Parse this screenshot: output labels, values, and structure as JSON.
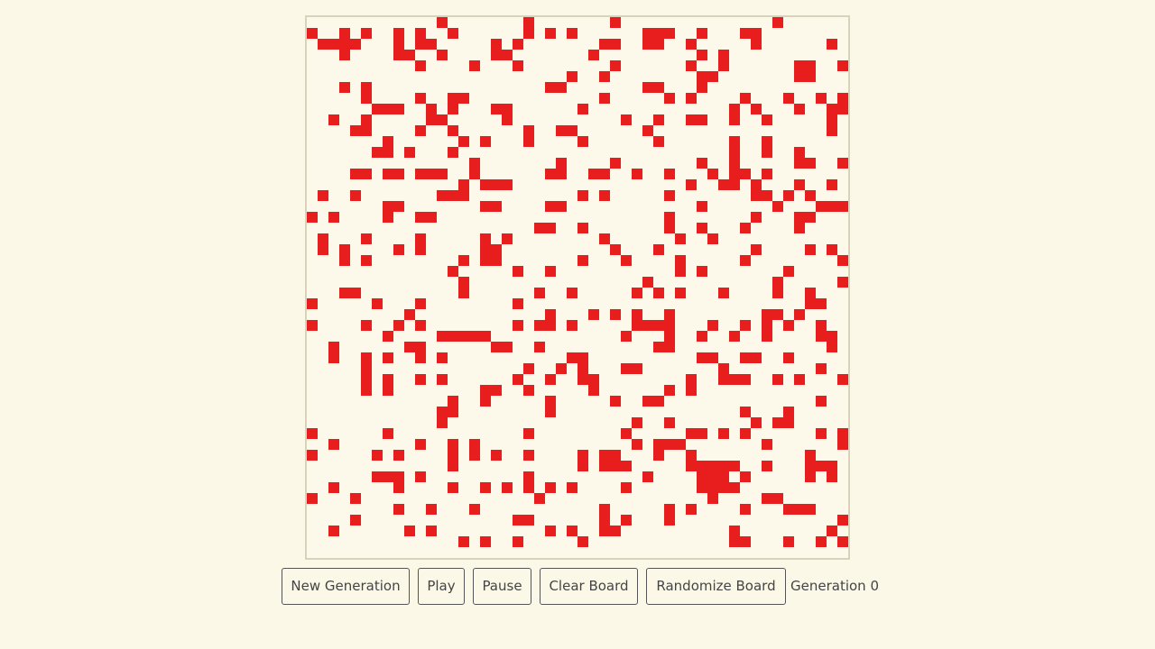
{
  "colors": {
    "background": "#fcf8e8",
    "alive_cell": "#e81e1e",
    "board_border": "#d8d4bc"
  },
  "board": {
    "columns": 50,
    "rows": 50,
    "alive_cells": [
      [
        12,
        0
      ],
      [
        20,
        0
      ],
      [
        28,
        0
      ],
      [
        43,
        0
      ],
      [
        0,
        1
      ],
      [
        3,
        1
      ],
      [
        5,
        1
      ],
      [
        8,
        1
      ],
      [
        10,
        1
      ],
      [
        13,
        1
      ],
      [
        20,
        1
      ],
      [
        22,
        1
      ],
      [
        24,
        1
      ],
      [
        31,
        1
      ],
      [
        32,
        1
      ],
      [
        33,
        1
      ],
      [
        36,
        1
      ],
      [
        40,
        1
      ],
      [
        41,
        1
      ],
      [
        1,
        2
      ],
      [
        2,
        2
      ],
      [
        3,
        2
      ],
      [
        4,
        2
      ],
      [
        8,
        2
      ],
      [
        10,
        2
      ],
      [
        11,
        2
      ],
      [
        17,
        2
      ],
      [
        19,
        2
      ],
      [
        27,
        2
      ],
      [
        28,
        2
      ],
      [
        31,
        2
      ],
      [
        32,
        2
      ],
      [
        35,
        2
      ],
      [
        41,
        2
      ],
      [
        48,
        2
      ],
      [
        3,
        3
      ],
      [
        8,
        3
      ],
      [
        9,
        3
      ],
      [
        12,
        3
      ],
      [
        17,
        3
      ],
      [
        18,
        3
      ],
      [
        26,
        3
      ],
      [
        36,
        3
      ],
      [
        38,
        3
      ],
      [
        10,
        4
      ],
      [
        15,
        4
      ],
      [
        19,
        4
      ],
      [
        28,
        4
      ],
      [
        35,
        4
      ],
      [
        38,
        4
      ],
      [
        45,
        4
      ],
      [
        46,
        4
      ],
      [
        49,
        4
      ],
      [
        24,
        5
      ],
      [
        27,
        5
      ],
      [
        36,
        5
      ],
      [
        37,
        5
      ],
      [
        45,
        5
      ],
      [
        46,
        5
      ],
      [
        3,
        6
      ],
      [
        5,
        6
      ],
      [
        22,
        6
      ],
      [
        23,
        6
      ],
      [
        31,
        6
      ],
      [
        32,
        6
      ],
      [
        36,
        6
      ],
      [
        5,
        7
      ],
      [
        10,
        7
      ],
      [
        13,
        7
      ],
      [
        14,
        7
      ],
      [
        27,
        7
      ],
      [
        33,
        7
      ],
      [
        35,
        7
      ],
      [
        40,
        7
      ],
      [
        44,
        7
      ],
      [
        47,
        7
      ],
      [
        49,
        7
      ],
      [
        6,
        8
      ],
      [
        7,
        8
      ],
      [
        8,
        8
      ],
      [
        11,
        8
      ],
      [
        13,
        8
      ],
      [
        17,
        8
      ],
      [
        18,
        8
      ],
      [
        25,
        8
      ],
      [
        39,
        8
      ],
      [
        41,
        8
      ],
      [
        45,
        8
      ],
      [
        48,
        8
      ],
      [
        49,
        8
      ],
      [
        2,
        9
      ],
      [
        5,
        9
      ],
      [
        11,
        9
      ],
      [
        12,
        9
      ],
      [
        18,
        9
      ],
      [
        29,
        9
      ],
      [
        32,
        9
      ],
      [
        35,
        9
      ],
      [
        36,
        9
      ],
      [
        39,
        9
      ],
      [
        42,
        9
      ],
      [
        48,
        9
      ],
      [
        4,
        10
      ],
      [
        5,
        10
      ],
      [
        10,
        10
      ],
      [
        13,
        10
      ],
      [
        20,
        10
      ],
      [
        23,
        10
      ],
      [
        24,
        10
      ],
      [
        31,
        10
      ],
      [
        48,
        10
      ],
      [
        7,
        11
      ],
      [
        14,
        11
      ],
      [
        16,
        11
      ],
      [
        20,
        11
      ],
      [
        25,
        11
      ],
      [
        32,
        11
      ],
      [
        39,
        11
      ],
      [
        42,
        11
      ],
      [
        6,
        12
      ],
      [
        7,
        12
      ],
      [
        9,
        12
      ],
      [
        13,
        12
      ],
      [
        39,
        12
      ],
      [
        42,
        12
      ],
      [
        45,
        12
      ],
      [
        15,
        13
      ],
      [
        23,
        13
      ],
      [
        28,
        13
      ],
      [
        36,
        13
      ],
      [
        39,
        13
      ],
      [
        45,
        13
      ],
      [
        46,
        13
      ],
      [
        49,
        13
      ],
      [
        4,
        14
      ],
      [
        5,
        14
      ],
      [
        7,
        14
      ],
      [
        8,
        14
      ],
      [
        10,
        14
      ],
      [
        11,
        14
      ],
      [
        12,
        14
      ],
      [
        15,
        14
      ],
      [
        22,
        14
      ],
      [
        23,
        14
      ],
      [
        26,
        14
      ],
      [
        27,
        14
      ],
      [
        30,
        14
      ],
      [
        33,
        14
      ],
      [
        37,
        14
      ],
      [
        39,
        14
      ],
      [
        40,
        14
      ],
      [
        42,
        14
      ],
      [
        14,
        15
      ],
      [
        16,
        15
      ],
      [
        17,
        15
      ],
      [
        18,
        15
      ],
      [
        35,
        15
      ],
      [
        38,
        15
      ],
      [
        39,
        15
      ],
      [
        41,
        15
      ],
      [
        45,
        15
      ],
      [
        48,
        15
      ],
      [
        1,
        16
      ],
      [
        4,
        16
      ],
      [
        12,
        16
      ],
      [
        13,
        16
      ],
      [
        14,
        16
      ],
      [
        25,
        16
      ],
      [
        27,
        16
      ],
      [
        33,
        16
      ],
      [
        41,
        16
      ],
      [
        42,
        16
      ],
      [
        44,
        16
      ],
      [
        46,
        16
      ],
      [
        7,
        17
      ],
      [
        8,
        17
      ],
      [
        16,
        17
      ],
      [
        17,
        17
      ],
      [
        22,
        17
      ],
      [
        23,
        17
      ],
      [
        36,
        17
      ],
      [
        43,
        17
      ],
      [
        47,
        17
      ],
      [
        48,
        17
      ],
      [
        49,
        17
      ],
      [
        0,
        18
      ],
      [
        2,
        18
      ],
      [
        7,
        18
      ],
      [
        10,
        18
      ],
      [
        11,
        18
      ],
      [
        33,
        18
      ],
      [
        41,
        18
      ],
      [
        45,
        18
      ],
      [
        46,
        18
      ],
      [
        21,
        19
      ],
      [
        22,
        19
      ],
      [
        25,
        19
      ],
      [
        33,
        19
      ],
      [
        36,
        19
      ],
      [
        40,
        19
      ],
      [
        45,
        19
      ],
      [
        1,
        20
      ],
      [
        5,
        20
      ],
      [
        10,
        20
      ],
      [
        16,
        20
      ],
      [
        18,
        20
      ],
      [
        27,
        20
      ],
      [
        34,
        20
      ],
      [
        37,
        20
      ],
      [
        1,
        21
      ],
      [
        3,
        21
      ],
      [
        8,
        21
      ],
      [
        10,
        21
      ],
      [
        16,
        21
      ],
      [
        17,
        21
      ],
      [
        28,
        21
      ],
      [
        32,
        21
      ],
      [
        41,
        21
      ],
      [
        46,
        21
      ],
      [
        48,
        21
      ],
      [
        3,
        22
      ],
      [
        5,
        22
      ],
      [
        14,
        22
      ],
      [
        16,
        22
      ],
      [
        17,
        22
      ],
      [
        25,
        22
      ],
      [
        29,
        22
      ],
      [
        34,
        22
      ],
      [
        40,
        22
      ],
      [
        49,
        22
      ],
      [
        13,
        23
      ],
      [
        19,
        23
      ],
      [
        22,
        23
      ],
      [
        34,
        23
      ],
      [
        36,
        23
      ],
      [
        44,
        23
      ],
      [
        14,
        24
      ],
      [
        31,
        24
      ],
      [
        43,
        24
      ],
      [
        49,
        24
      ],
      [
        3,
        25
      ],
      [
        4,
        25
      ],
      [
        14,
        25
      ],
      [
        21,
        25
      ],
      [
        24,
        25
      ],
      [
        30,
        25
      ],
      [
        32,
        25
      ],
      [
        34,
        25
      ],
      [
        38,
        25
      ],
      [
        43,
        25
      ],
      [
        46,
        25
      ],
      [
        0,
        26
      ],
      [
        6,
        26
      ],
      [
        10,
        26
      ],
      [
        19,
        26
      ],
      [
        46,
        26
      ],
      [
        47,
        26
      ],
      [
        9,
        27
      ],
      [
        22,
        27
      ],
      [
        26,
        27
      ],
      [
        28,
        27
      ],
      [
        30,
        27
      ],
      [
        33,
        27
      ],
      [
        42,
        27
      ],
      [
        43,
        27
      ],
      [
        45,
        27
      ],
      [
        0,
        28
      ],
      [
        5,
        28
      ],
      [
        8,
        28
      ],
      [
        10,
        28
      ],
      [
        19,
        28
      ],
      [
        21,
        28
      ],
      [
        22,
        28
      ],
      [
        24,
        28
      ],
      [
        30,
        28
      ],
      [
        31,
        28
      ],
      [
        32,
        28
      ],
      [
        33,
        28
      ],
      [
        37,
        28
      ],
      [
        40,
        28
      ],
      [
        42,
        28
      ],
      [
        44,
        28
      ],
      [
        47,
        28
      ],
      [
        7,
        29
      ],
      [
        12,
        29
      ],
      [
        13,
        29
      ],
      [
        14,
        29
      ],
      [
        15,
        29
      ],
      [
        16,
        29
      ],
      [
        29,
        29
      ],
      [
        33,
        29
      ],
      [
        36,
        29
      ],
      [
        39,
        29
      ],
      [
        42,
        29
      ],
      [
        47,
        29
      ],
      [
        48,
        29
      ],
      [
        2,
        30
      ],
      [
        9,
        30
      ],
      [
        10,
        30
      ],
      [
        17,
        30
      ],
      [
        18,
        30
      ],
      [
        21,
        30
      ],
      [
        32,
        30
      ],
      [
        33,
        30
      ],
      [
        48,
        30
      ],
      [
        2,
        31
      ],
      [
        5,
        31
      ],
      [
        7,
        31
      ],
      [
        10,
        31
      ],
      [
        12,
        31
      ],
      [
        24,
        31
      ],
      [
        25,
        31
      ],
      [
        36,
        31
      ],
      [
        37,
        31
      ],
      [
        40,
        31
      ],
      [
        41,
        31
      ],
      [
        44,
        31
      ],
      [
        5,
        32
      ],
      [
        20,
        32
      ],
      [
        23,
        32
      ],
      [
        25,
        32
      ],
      [
        29,
        32
      ],
      [
        30,
        32
      ],
      [
        38,
        32
      ],
      [
        47,
        32
      ],
      [
        5,
        33
      ],
      [
        7,
        33
      ],
      [
        10,
        33
      ],
      [
        12,
        33
      ],
      [
        19,
        33
      ],
      [
        22,
        33
      ],
      [
        25,
        33
      ],
      [
        26,
        33
      ],
      [
        35,
        33
      ],
      [
        38,
        33
      ],
      [
        39,
        33
      ],
      [
        40,
        33
      ],
      [
        43,
        33
      ],
      [
        45,
        33
      ],
      [
        49,
        33
      ],
      [
        5,
        34
      ],
      [
        7,
        34
      ],
      [
        16,
        34
      ],
      [
        17,
        34
      ],
      [
        20,
        34
      ],
      [
        26,
        34
      ],
      [
        33,
        34
      ],
      [
        35,
        34
      ],
      [
        13,
        35
      ],
      [
        16,
        35
      ],
      [
        22,
        35
      ],
      [
        28,
        35
      ],
      [
        31,
        35
      ],
      [
        32,
        35
      ],
      [
        47,
        35
      ],
      [
        12,
        36
      ],
      [
        13,
        36
      ],
      [
        22,
        36
      ],
      [
        40,
        36
      ],
      [
        44,
        36
      ],
      [
        12,
        37
      ],
      [
        30,
        37
      ],
      [
        33,
        37
      ],
      [
        41,
        37
      ],
      [
        43,
        37
      ],
      [
        44,
        37
      ],
      [
        0,
        38
      ],
      [
        7,
        38
      ],
      [
        20,
        38
      ],
      [
        29,
        38
      ],
      [
        35,
        38
      ],
      [
        36,
        38
      ],
      [
        38,
        38
      ],
      [
        40,
        38
      ],
      [
        47,
        38
      ],
      [
        49,
        38
      ],
      [
        2,
        39
      ],
      [
        10,
        39
      ],
      [
        13,
        39
      ],
      [
        15,
        39
      ],
      [
        30,
        39
      ],
      [
        32,
        39
      ],
      [
        33,
        39
      ],
      [
        34,
        39
      ],
      [
        42,
        39
      ],
      [
        49,
        39
      ],
      [
        0,
        40
      ],
      [
        6,
        40
      ],
      [
        8,
        40
      ],
      [
        13,
        40
      ],
      [
        15,
        40
      ],
      [
        17,
        40
      ],
      [
        20,
        40
      ],
      [
        25,
        40
      ],
      [
        27,
        40
      ],
      [
        28,
        40
      ],
      [
        32,
        40
      ],
      [
        35,
        40
      ],
      [
        46,
        40
      ],
      [
        13,
        41
      ],
      [
        25,
        41
      ],
      [
        27,
        41
      ],
      [
        28,
        41
      ],
      [
        29,
        41
      ],
      [
        35,
        41
      ],
      [
        36,
        41
      ],
      [
        37,
        41
      ],
      [
        38,
        41
      ],
      [
        39,
        41
      ],
      [
        42,
        41
      ],
      [
        46,
        41
      ],
      [
        47,
        41
      ],
      [
        48,
        41
      ],
      [
        6,
        42
      ],
      [
        7,
        42
      ],
      [
        8,
        42
      ],
      [
        10,
        42
      ],
      [
        20,
        42
      ],
      [
        31,
        42
      ],
      [
        36,
        42
      ],
      [
        37,
        42
      ],
      [
        38,
        42
      ],
      [
        40,
        42
      ],
      [
        46,
        42
      ],
      [
        48,
        42
      ],
      [
        2,
        43
      ],
      [
        8,
        43
      ],
      [
        13,
        43
      ],
      [
        16,
        43
      ],
      [
        18,
        43
      ],
      [
        20,
        43
      ],
      [
        22,
        43
      ],
      [
        24,
        43
      ],
      [
        29,
        43
      ],
      [
        36,
        43
      ],
      [
        37,
        43
      ],
      [
        38,
        43
      ],
      [
        39,
        43
      ],
      [
        0,
        44
      ],
      [
        4,
        44
      ],
      [
        21,
        44
      ],
      [
        37,
        44
      ],
      [
        42,
        44
      ],
      [
        43,
        44
      ],
      [
        8,
        45
      ],
      [
        11,
        45
      ],
      [
        15,
        45
      ],
      [
        27,
        45
      ],
      [
        33,
        45
      ],
      [
        35,
        45
      ],
      [
        40,
        45
      ],
      [
        44,
        45
      ],
      [
        45,
        45
      ],
      [
        46,
        45
      ],
      [
        4,
        46
      ],
      [
        19,
        46
      ],
      [
        20,
        46
      ],
      [
        27,
        46
      ],
      [
        29,
        46
      ],
      [
        33,
        46
      ],
      [
        49,
        46
      ],
      [
        2,
        47
      ],
      [
        9,
        47
      ],
      [
        11,
        47
      ],
      [
        22,
        47
      ],
      [
        24,
        47
      ],
      [
        27,
        47
      ],
      [
        28,
        47
      ],
      [
        39,
        47
      ],
      [
        48,
        47
      ],
      [
        14,
        48
      ],
      [
        16,
        48
      ],
      [
        19,
        48
      ],
      [
        25,
        48
      ],
      [
        39,
        48
      ],
      [
        40,
        48
      ],
      [
        44,
        48
      ],
      [
        47,
        48
      ],
      [
        49,
        48
      ]
    ]
  },
  "controls": {
    "new_generation_label": "New Generation",
    "play_label": "Play",
    "pause_label": "Pause",
    "clear_board_label": "Clear Board",
    "randomize_board_label": "Randomize Board",
    "generation_text": "Generation 0"
  }
}
